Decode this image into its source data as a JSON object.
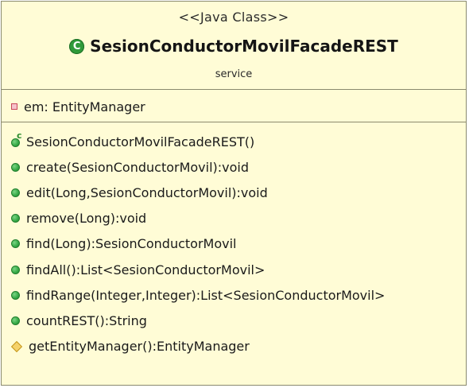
{
  "uml_class": {
    "stereotype": "<<Java Class>>",
    "class_icon": "C",
    "name": "SesionConductorMovilFacadeREST",
    "package": "service",
    "attributes": [
      {
        "visibility": "private",
        "text": "em: EntityManager"
      }
    ],
    "methods": [
      {
        "visibility": "constructor",
        "text": "SesionConductorMovilFacadeREST()"
      },
      {
        "visibility": "public",
        "text": "create(SesionConductorMovil):void"
      },
      {
        "visibility": "public",
        "text": "edit(Long,SesionConductorMovil):void"
      },
      {
        "visibility": "public",
        "text": "remove(Long):void"
      },
      {
        "visibility": "public",
        "text": "find(Long):SesionConductorMovil"
      },
      {
        "visibility": "public",
        "text": "findAll():List<SesionConductorMovil>"
      },
      {
        "visibility": "public",
        "text": "findRange(Integer,Integer):List<SesionConductorMovil>"
      },
      {
        "visibility": "public",
        "text": "countREST():String"
      },
      {
        "visibility": "protected",
        "text": "getEntityManager():EntityManager"
      }
    ],
    "constructor_mark": "c",
    "colors": {
      "fill": "#fffcd6",
      "border": "#8a8a6e",
      "public": "#34a845",
      "private": "#c9485b",
      "protected": "#f5d26b"
    }
  }
}
